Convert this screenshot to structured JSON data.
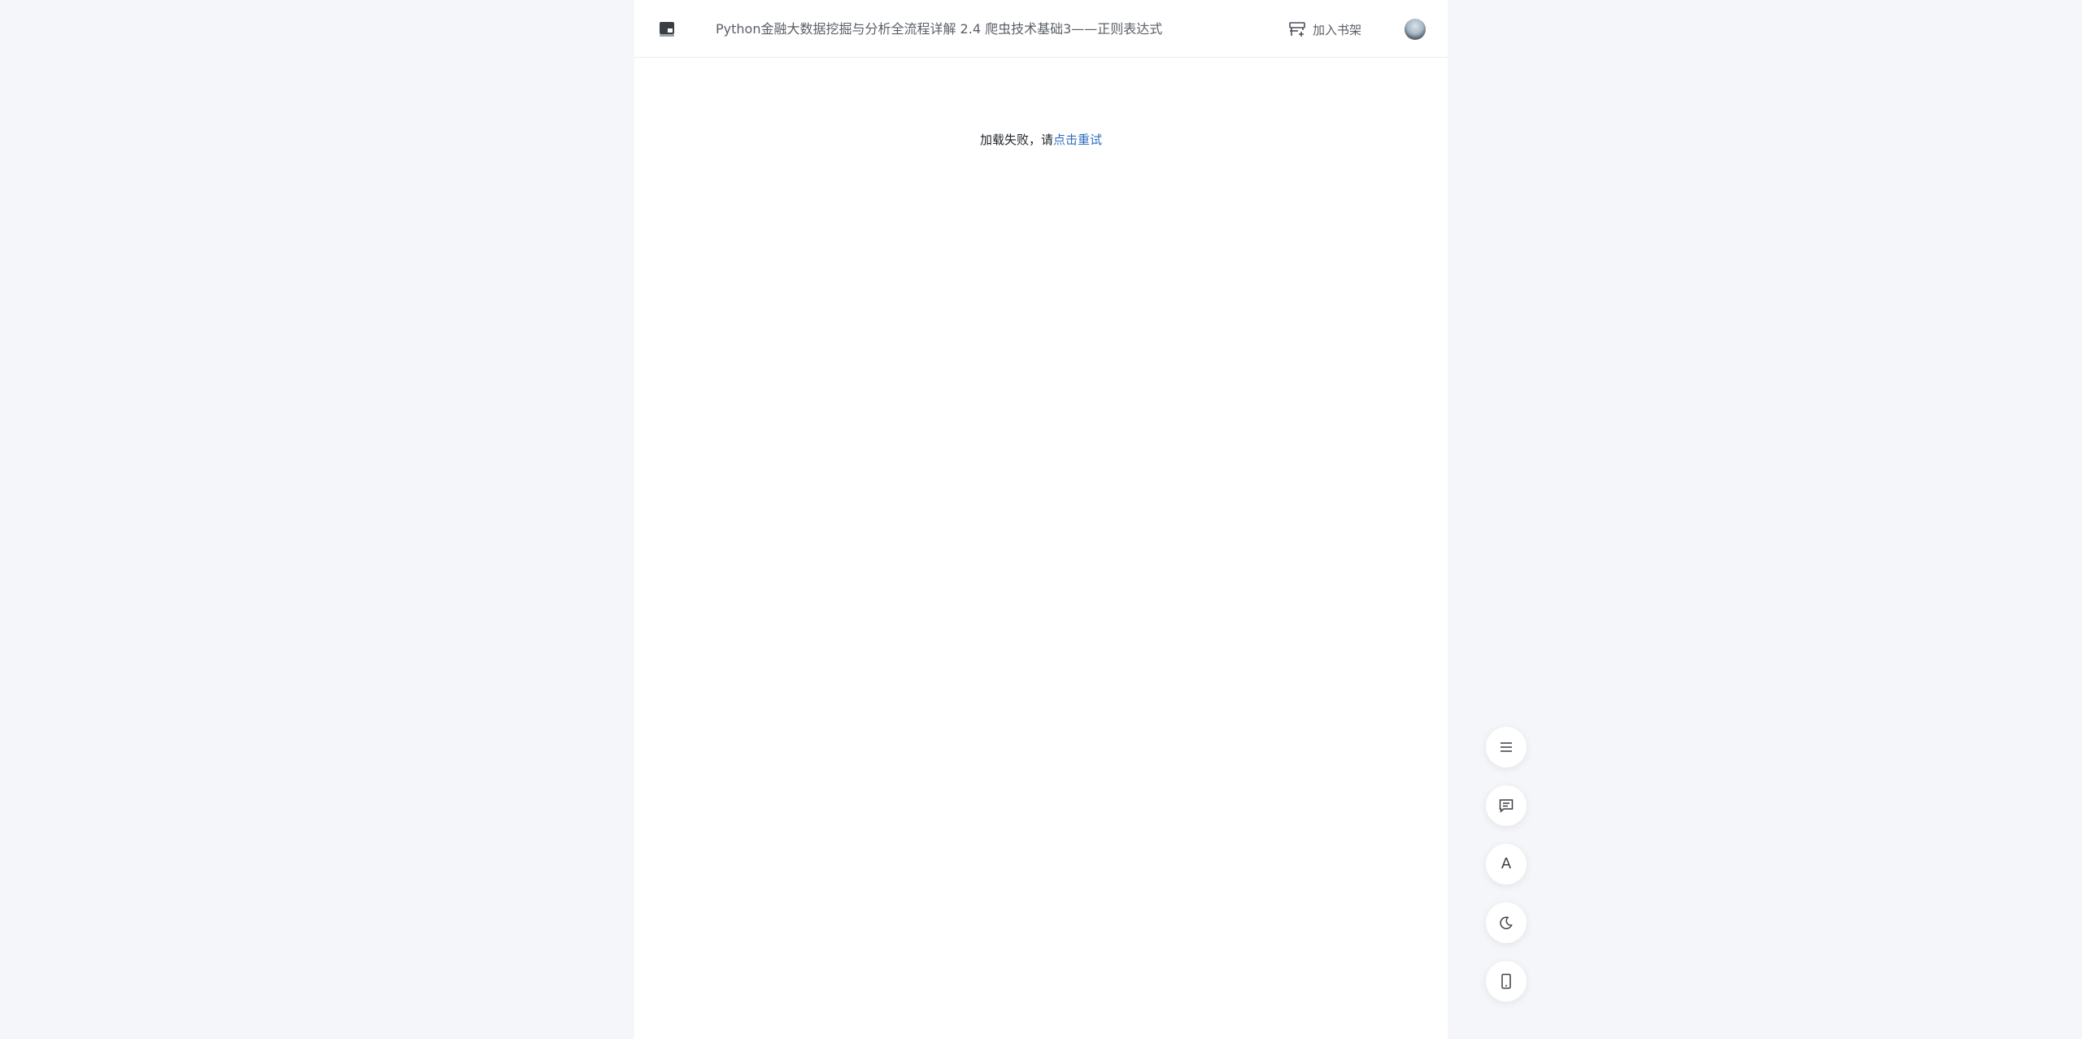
{
  "header": {
    "logo_icon": "book-logo-icon",
    "title": "Python金融大数据挖掘与分析全流程详解 2.4 爬虫技术基础3——正则表达式",
    "shelf_button_label": "加入书架",
    "shelf_icon": "bookshelf-add-icon",
    "avatar_icon": "user-avatar"
  },
  "content": {
    "error_text": "加载失败，请",
    "retry_link": "点击重试"
  },
  "toolbar": {
    "items": [
      {
        "name": "catalog",
        "icon": "menu-icon"
      },
      {
        "name": "comments",
        "icon": "comment-icon"
      },
      {
        "name": "font",
        "icon": "font-size-icon",
        "label": "A"
      },
      {
        "name": "night-mode",
        "icon": "moon-icon"
      },
      {
        "name": "mobile-read",
        "icon": "phone-icon"
      }
    ]
  },
  "colors": {
    "page_background": "#f4f6f9",
    "reader_background": "#ffffff",
    "link": "#2f6fbf",
    "text": "#1f2329",
    "muted_text": "#5a5f66"
  }
}
